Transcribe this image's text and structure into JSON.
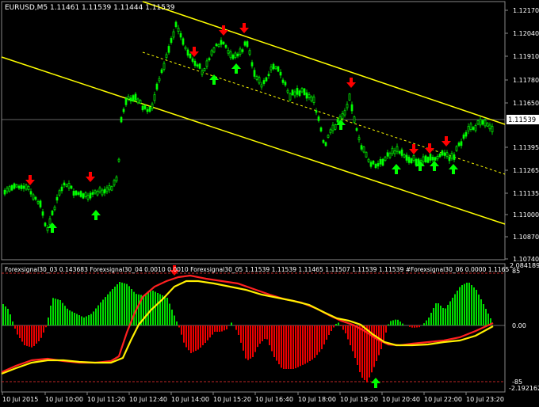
{
  "header": {
    "symbol_line": "EURUSD,M5  1.11461 1.11539 1.11444 1.11539"
  },
  "price_axis": {
    "labels": [
      "1.12170",
      "1.12040",
      "1.11910",
      "1.11780",
      "1.11650",
      "1.11395",
      "1.11265",
      "1.11135",
      "1.11000",
      "1.10870",
      "1.10740"
    ],
    "current_price": "1.11539"
  },
  "indicator_panel": {
    "title": "Forexsignal30_03 0.143683  Forexsignal30_04 0.0010 0.0010  Forexsignal30_05 1.11539 1.11539 1.11465 1.11507 1.11539 1.11539  #Forexsignal30_06 0.0000 1.1165",
    "levels": [
      "85",
      "0.00",
      "-85"
    ],
    "extra_labels": [
      "2.084189",
      "-2.192162"
    ]
  },
  "time_axis": {
    "labels": [
      "10 Jul 2015",
      "10 Jul 10:00",
      "10 Jul 11:20",
      "10 Jul 12:40",
      "10 Jul 14:00",
      "10 Jul 15:20",
      "10 Jul 16:40",
      "10 Jul 18:00",
      "10 Jul 19:20",
      "10 Jul 20:40",
      "10 Jul 22:00",
      "10 Jul 23:20"
    ]
  },
  "colors": {
    "background": "#000000",
    "candle": "#00ff00",
    "channel": "#ffff00",
    "sell_arrow": "#ff0000",
    "buy_arrow": "#00ff00",
    "axis_text": "#ffffff",
    "hist_pos": "#00dd00",
    "hist_neg": "#ee0000",
    "level_line": "#ff3333"
  },
  "signals": {
    "sell_icon": "arrow-down-icon",
    "buy_icon": "arrow-up-icon"
  }
}
